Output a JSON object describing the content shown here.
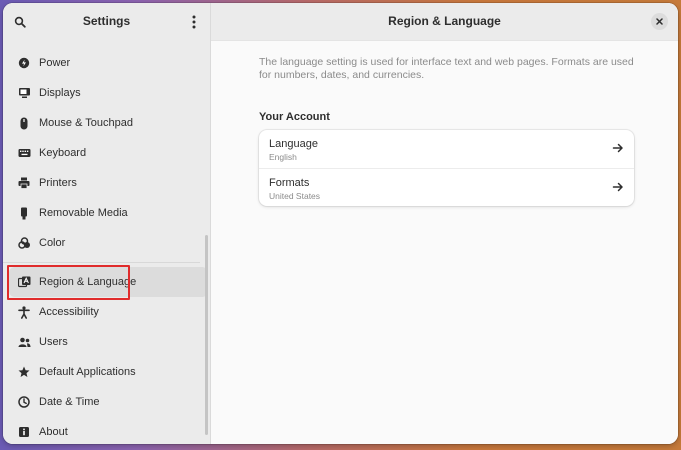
{
  "sidebar": {
    "title": "Settings",
    "search_icon": "search-icon",
    "menu_icon": "kebab-menu-icon",
    "items": [
      {
        "label": "Power",
        "icon": "power-icon"
      },
      {
        "label": "Displays",
        "icon": "display-icon"
      },
      {
        "label": "Mouse & Touchpad",
        "icon": "mouse-icon"
      },
      {
        "label": "Keyboard",
        "icon": "keyboard-icon"
      },
      {
        "label": "Printers",
        "icon": "printer-icon"
      },
      {
        "label": "Removable Media",
        "icon": "usb-icon"
      },
      {
        "label": "Color",
        "icon": "color-icon"
      },
      {
        "label": "Region & Language",
        "icon": "region-language-icon",
        "selected": true
      },
      {
        "label": "Accessibility",
        "icon": "accessibility-icon"
      },
      {
        "label": "Users",
        "icon": "users-icon"
      },
      {
        "label": "Default Applications",
        "icon": "default-apps-icon"
      },
      {
        "label": "Date & Time",
        "icon": "clock-icon"
      },
      {
        "label": "About",
        "icon": "info-icon"
      }
    ]
  },
  "main": {
    "title": "Region & Language",
    "description": "The language setting is used for interface text and web pages. Formats are used for numbers, dates, and currencies.",
    "section_title": "Your Account",
    "rows": [
      {
        "title": "Language",
        "subtitle": "English"
      },
      {
        "title": "Formats",
        "subtitle": "United States"
      }
    ]
  },
  "colors": {
    "highlight": "#e02b2b",
    "selected_bg": "#dcdcdc"
  }
}
